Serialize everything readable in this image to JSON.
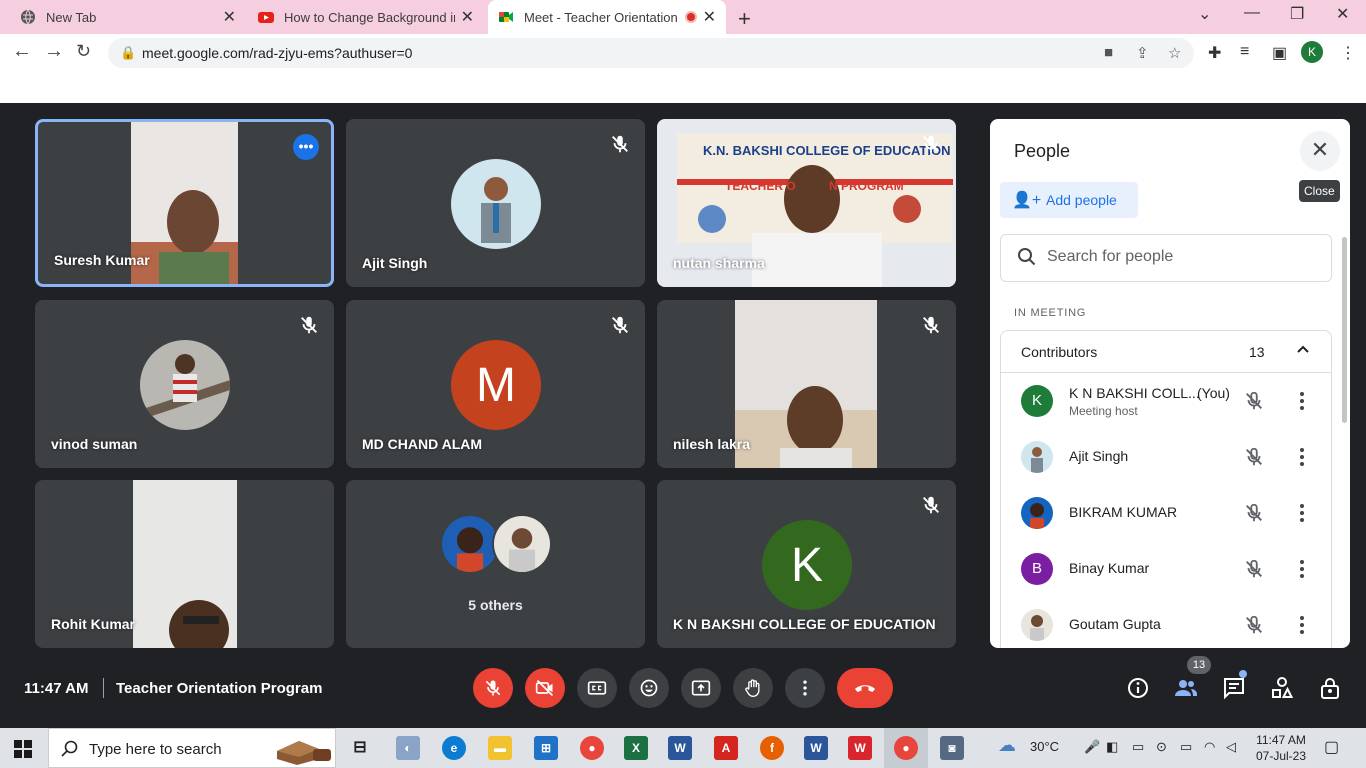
{
  "browser": {
    "tabs": [
      {
        "title": "New Tab",
        "active": false
      },
      {
        "title": "How to Change Background in G",
        "active": false
      },
      {
        "title": "Meet - Teacher Orientation P",
        "active": true
      }
    ],
    "url": "meet.google.com/rad-zjyu-ems?authuser=0",
    "profile_initial": "K"
  },
  "tiles": [
    {
      "name": "Suresh Kumar",
      "speaking": true,
      "muted": false,
      "kind": "video"
    },
    {
      "name": "Ajit Singh",
      "muted": true,
      "kind": "avatar"
    },
    {
      "name": "nutan sharma",
      "muted": true,
      "kind": "video"
    },
    {
      "name": "vinod suman",
      "muted": true,
      "kind": "avatar"
    },
    {
      "name": "MD CHAND ALAM",
      "muted": true,
      "kind": "letter",
      "letter": "M",
      "color": "#c5421e"
    },
    {
      "name": "nilesh lakra",
      "muted": true,
      "kind": "video"
    },
    {
      "name": "Rohit Kumar",
      "muted": false,
      "kind": "video"
    },
    {
      "name": "5 others",
      "kind": "others"
    },
    {
      "name": "K N BAKSHI COLLEGE OF EDUCATION",
      "muted": true,
      "kind": "letter",
      "letter": "K",
      "color": "#33691e"
    }
  ],
  "banner_text": {
    "college": "K.N. BAKSHI COLLEGE OF EDUCATION",
    "program": "TEACHER O          N PROGRAM"
  },
  "people_panel": {
    "title": "People",
    "close_tooltip": "Close",
    "add_people_label": "Add people",
    "search_placeholder": "Search for people",
    "section_label": "IN MEETING",
    "group_label": "Contributors",
    "group_count": "13",
    "people": [
      {
        "name": "K N BAKSHI COLL...",
        "suffix": "(You)",
        "role": "Meeting host",
        "initial": "K",
        "color": "#1e7b3a"
      },
      {
        "name": "Ajit Singh",
        "initial": "",
        "color": "#9fb3c8"
      },
      {
        "name": "BIKRAM KUMAR",
        "initial": "",
        "color": "#1565c0"
      },
      {
        "name": "Binay Kumar",
        "initial": "B",
        "color": "#7b1fa2"
      },
      {
        "name": "Goutam Gupta",
        "initial": "",
        "color": "#b0b0b0"
      }
    ]
  },
  "meeting": {
    "time": "11:47 AM",
    "title": "Teacher Orientation Program",
    "participants_badge": "13"
  },
  "taskbar": {
    "search_text": "Type here to search",
    "weather": "30°C",
    "time": "11:47 AM",
    "date": "07-Jul-23"
  }
}
